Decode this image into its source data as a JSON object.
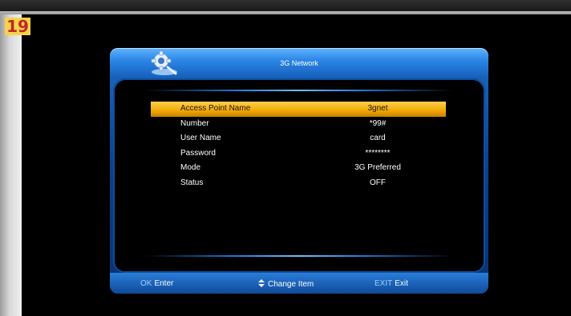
{
  "page_number": "19",
  "window": {
    "title": "3G Network"
  },
  "settings": [
    {
      "label": "Access Point Name",
      "value": "3gnet",
      "selected": true
    },
    {
      "label": "Number",
      "value": "*99#"
    },
    {
      "label": "User Name",
      "value": "card"
    },
    {
      "label": "Password",
      "value": "********"
    },
    {
      "label": "Mode",
      "value": "3G Preferred"
    },
    {
      "label": "Status",
      "value": "OFF"
    }
  ],
  "footer": {
    "ok_key": "OK",
    "ok_label": "Enter",
    "change_label": "Change Item",
    "exit_key": "EXIT",
    "exit_label": "Exit"
  },
  "colors": {
    "accent": "#1d6bc5",
    "highlight": "#f0a800",
    "page_badge": "#f6d34a"
  },
  "icons": [
    "settings-gear-icon",
    "up-down-arrow-icon"
  ]
}
